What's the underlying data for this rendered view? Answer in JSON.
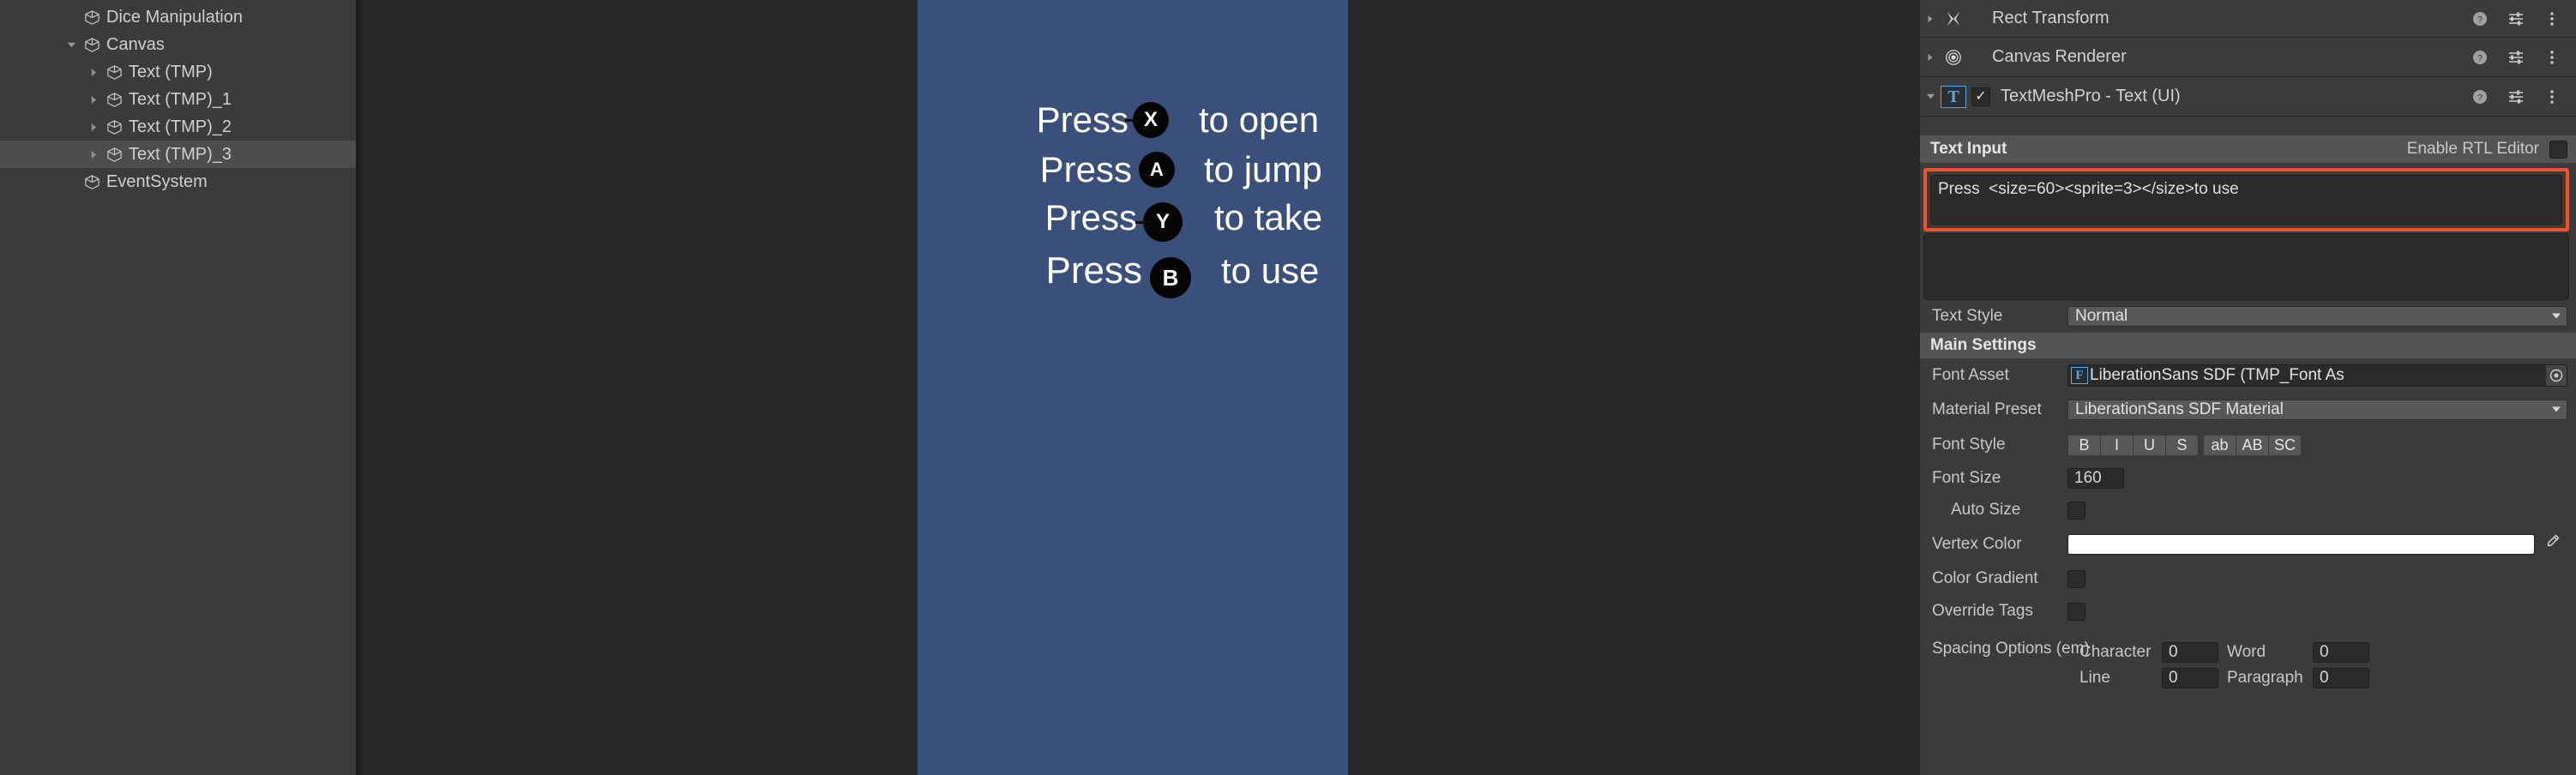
{
  "hierarchy": {
    "items": [
      {
        "label": "Dice Manipulation",
        "depth": 1,
        "arrow": "none",
        "selected": false
      },
      {
        "label": "Canvas",
        "depth": 1,
        "arrow": "down",
        "selected": false
      },
      {
        "label": "Text (TMP)",
        "depth": 2,
        "arrow": "right",
        "selected": false
      },
      {
        "label": "Text (TMP)_1",
        "depth": 2,
        "arrow": "right",
        "selected": false
      },
      {
        "label": "Text (TMP)_2",
        "depth": 2,
        "arrow": "right",
        "selected": false
      },
      {
        "label": "Text (TMP)_3",
        "depth": 2,
        "arrow": "right",
        "selected": true
      },
      {
        "label": "EventSystem",
        "depth": 1,
        "arrow": "none",
        "selected": false
      }
    ]
  },
  "game_view": {
    "background_color": "#3a4f7a",
    "prompts": [
      {
        "press": "Press",
        "button": "X",
        "action": "to open",
        "has_dash": true
      },
      {
        "press": "Press",
        "button": "A",
        "action": "to jump",
        "has_dash": false
      },
      {
        "press": "Press",
        "button": "Y",
        "action": "to take",
        "has_dash": true
      },
      {
        "press": "Press",
        "button": "B",
        "action": "to use",
        "has_dash": false
      }
    ]
  },
  "inspector": {
    "components": [
      {
        "name": "Rect Transform",
        "icon": "rect-transform-icon",
        "foldout": "right",
        "has_checkbox": false,
        "enabled": false
      },
      {
        "name": "Canvas Renderer",
        "icon": "canvas-renderer-icon",
        "foldout": "right",
        "has_checkbox": false,
        "enabled": false
      },
      {
        "name": "TextMeshPro - Text (UI)",
        "icon": "textmeshpro-icon",
        "foldout": "down",
        "has_checkbox": true,
        "enabled": true
      }
    ],
    "text_input": {
      "title": "Text Input",
      "rtl_label": "Enable RTL Editor",
      "rtl_checked": false,
      "value": "Press  <size=60><sprite=3></size>to use",
      "highlight_color": "#f0522b"
    },
    "text_style": {
      "label": "Text Style",
      "value": "Normal"
    },
    "main_settings": {
      "section_label": "Main Settings",
      "font_asset": {
        "label": "Font Asset",
        "value": "LiberationSans SDF (TMP_Font As",
        "icon_letter": "F"
      },
      "material_preset": {
        "label": "Material Preset",
        "value": "LiberationSans SDF Material"
      },
      "font_style": {
        "label": "Font Style",
        "buttons": [
          "B",
          "I",
          "U",
          "S",
          "ab",
          "AB",
          "SC"
        ]
      },
      "font_size": {
        "label": "Font Size",
        "value": "160"
      },
      "auto_size": {
        "label": "Auto Size",
        "checked": false
      },
      "vertex_color": {
        "label": "Vertex Color",
        "color": "#ffffff"
      },
      "color_gradient": {
        "label": "Color Gradient",
        "checked": false
      },
      "override_tags": {
        "label": "Override Tags",
        "checked": false
      },
      "spacing": {
        "label": "Spacing Options (em)",
        "character_label": "Character",
        "character_value": "0",
        "word_label": "Word",
        "word_value": "0",
        "line_label": "Line",
        "line_value": "0",
        "paragraph_label": "Paragraph",
        "paragraph_value": "0"
      }
    }
  }
}
